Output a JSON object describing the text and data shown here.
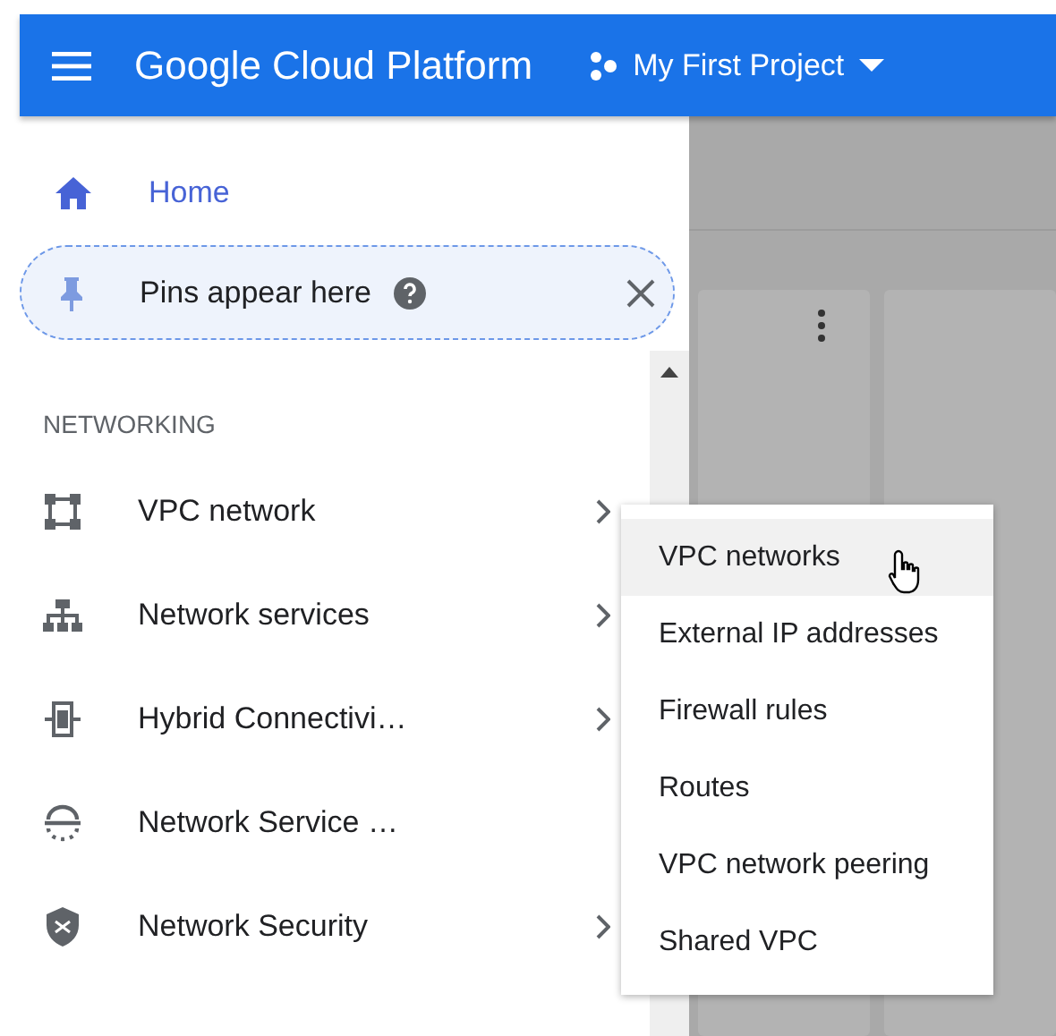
{
  "top_bar": {
    "title": "Google Cloud Platform",
    "project": "My First Project"
  },
  "sidebar": {
    "home": {
      "label": "Home",
      "selected": true
    },
    "pins": {
      "text": "Pins appear here"
    },
    "section": "NETWORKING",
    "items": [
      {
        "label": "VPC network",
        "expandable": true
      },
      {
        "label": "Network services",
        "expandable": true
      },
      {
        "label": "Hybrid Connectivi…",
        "expandable": true
      },
      {
        "label": "Network Service …",
        "expandable": false
      },
      {
        "label": "Network Security",
        "expandable": true
      }
    ]
  },
  "flyout_menu": [
    {
      "label": "VPC networks",
      "selected": true
    },
    {
      "label": "External IP addresses",
      "selected": false
    },
    {
      "label": "Firewall rules",
      "selected": false
    },
    {
      "label": "Routes",
      "selected": false
    },
    {
      "label": "VPC network peering",
      "selected": false
    },
    {
      "label": "Shared VPC",
      "selected": false
    }
  ]
}
